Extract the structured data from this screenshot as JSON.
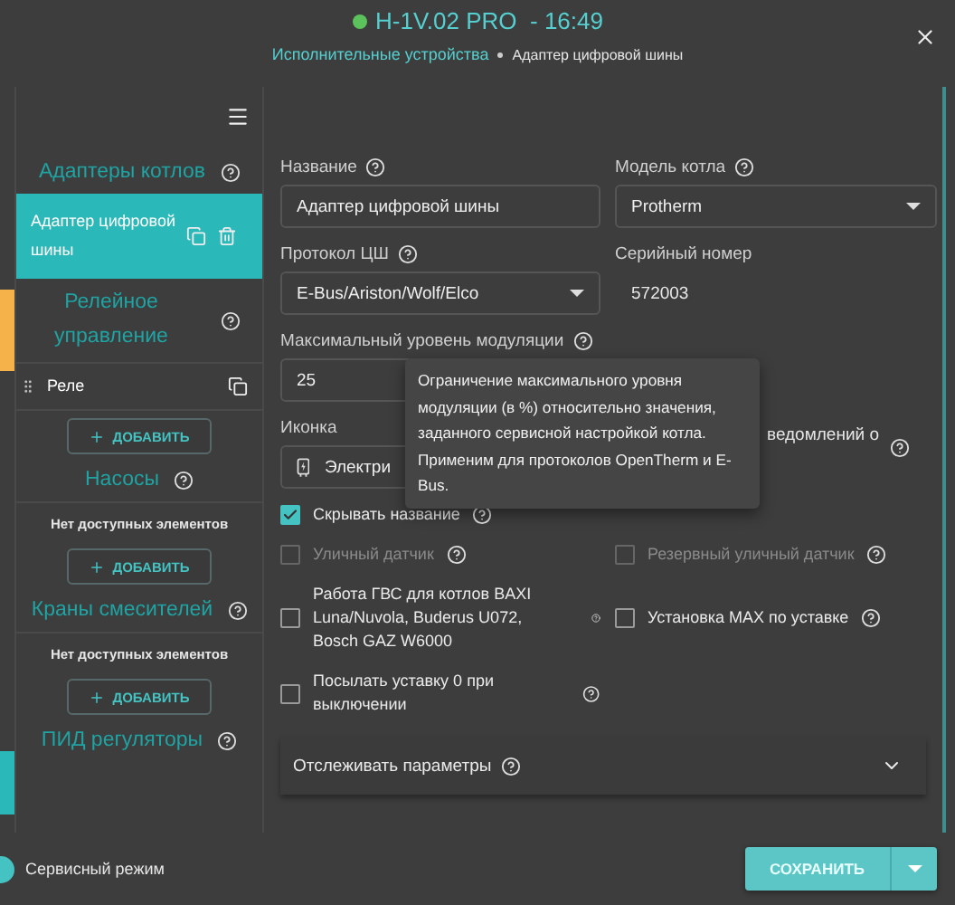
{
  "header": {
    "connected": true,
    "title": "H-1V.02 PRO  - 16:49",
    "breadcrumb": [
      "Исполнительные устройства",
      "Адаптер цифровой шины"
    ]
  },
  "sidebar": {
    "sections": [
      {
        "title": "Адаптеры котлов",
        "items": [
          {
            "label": "Адаптер цифровой шины",
            "selected": true,
            "deletable": true
          }
        ]
      },
      {
        "title": "Релейное управление",
        "items": [
          {
            "label": "Реле",
            "selected": false,
            "deletable": false
          }
        ],
        "add": "ДОБАВИТЬ"
      },
      {
        "title": "Насосы",
        "empty": "Нет доступных элементов",
        "add": "ДОБАВИТЬ"
      },
      {
        "title": "Краны смесителей",
        "empty": "Нет доступных элементов",
        "add": "ДОБАВИТЬ"
      },
      {
        "title": "ПИД регуляторы"
      }
    ]
  },
  "form": {
    "name": {
      "label": "Название",
      "value": "Адаптер цифровой шины"
    },
    "boiler_model": {
      "label": "Модель котла",
      "value": "Protherm"
    },
    "protocol": {
      "label": "Протокол ЦШ",
      "value": "E-Bus/Ariston/Wolf/Elco"
    },
    "serial": {
      "label": "Серийный номер",
      "value": "572003"
    },
    "max_modulation": {
      "label": "Максимальный уровень модуляции",
      "value": "25"
    },
    "tooltip": "Ограничение максимального уровня модуляции (в %) относительно значения, заданного сервисной настройкой котла. Применим для протоколов OpenTherm и E-Bus.",
    "icon": {
      "label": "Иконка",
      "value": "Электри"
    },
    "notify": {
      "label": "ведомлений о"
    },
    "option_rows": [
      [
        {
          "label": "Скрывать название",
          "checked": true,
          "disabled": false
        }
      ],
      [
        {
          "label": "Уличный датчик",
          "checked": false,
          "disabled": true
        },
        {
          "label": "Резервный уличный датчик",
          "checked": false,
          "disabled": true
        }
      ],
      [
        {
          "label": "Работа ГВС для котлов BAXI Luna/Nuvola, Buderus U072, Bosch GAZ W6000",
          "checked": false,
          "disabled": false
        },
        {
          "label": "Установка MAX по уставке",
          "checked": false,
          "disabled": false
        }
      ],
      [
        {
          "label": "Посылать уставку 0 при выключении",
          "checked": false,
          "disabled": false
        }
      ]
    ],
    "accordion": {
      "title": "Отслеживать параметры",
      "expanded": false
    }
  },
  "footer": {
    "service_mode": {
      "label": "Сервисный режим",
      "on": true
    },
    "save": "СОХРАНИТЬ"
  }
}
